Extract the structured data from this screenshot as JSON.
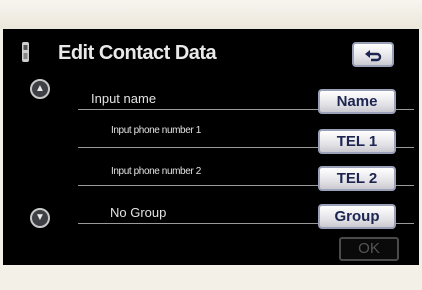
{
  "header": {
    "title": "Edit Contact Data",
    "phone_icon": "phone-handset-icon",
    "back_icon": "return-arrow-icon"
  },
  "scroll": {
    "up_icon": "scroll-up-icon",
    "down_icon": "scroll-down-icon",
    "up_glyph": "▲",
    "down_glyph": "▼"
  },
  "rows": [
    {
      "label": "Input name",
      "button": "Name"
    },
    {
      "label": "Input phone number 1",
      "button": "TEL 1"
    },
    {
      "label": "Input phone number 2",
      "button": "TEL 2"
    },
    {
      "label": "No Group",
      "button": "Group"
    }
  ],
  "footer": {
    "ok_label": "OK",
    "ok_enabled": false
  },
  "colors": {
    "screen_bg": "#000000",
    "button_text": "#1d2550",
    "button_border": "#9aa0b8"
  }
}
